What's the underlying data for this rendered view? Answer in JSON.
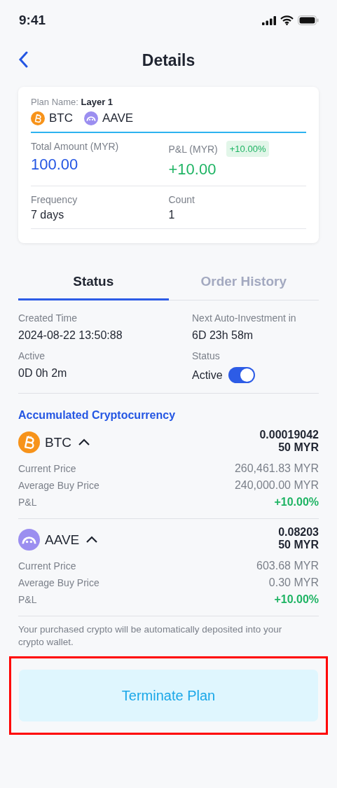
{
  "status_bar": {
    "time": "9:41"
  },
  "header": {
    "title": "Details"
  },
  "plan_card": {
    "plan_name_label": "Plan Name:",
    "plan_name": "Layer 1",
    "coins": [
      {
        "kind": "btc",
        "symbol": "BTC"
      },
      {
        "kind": "aave",
        "symbol": "AAVE"
      }
    ],
    "total_amount": {
      "label": "Total Amount (MYR)",
      "value": "100.00"
    },
    "pnl": {
      "label": "P&L (MYR)",
      "badge": "+10.00%",
      "value": "+10.00"
    },
    "frequency": {
      "label": "Frequency",
      "value": "7 days"
    },
    "count": {
      "label": "Count",
      "value": "1"
    }
  },
  "tabs": [
    {
      "label": "Status",
      "selected": true
    },
    {
      "label": "Order History",
      "selected": false
    }
  ],
  "status_info": {
    "created_label": "Created Time",
    "created_value": "2024-08-22 13:50:88",
    "next_label": "Next Auto-Investment in",
    "next_value": "6D 23h 58m",
    "active_label": "Active",
    "active_value": "0D 0h 2m",
    "status_label": "Status",
    "status_value": "Active",
    "toggle_on": true
  },
  "accumulated": {
    "title": "Accumulated Cryptocurrency",
    "assets": [
      {
        "kind": "btc",
        "symbol": "BTC",
        "expanded": true,
        "amount": "0.00019042",
        "value": "50 MYR",
        "rows": [
          {
            "kind": "plain",
            "label": "Current Price",
            "value": "260,461.83 MYR"
          },
          {
            "kind": "plain",
            "label": "Average Buy Price",
            "value": "240,000.00 MYR"
          },
          {
            "kind": "gain",
            "label": "P&L",
            "value": "+10.00%"
          }
        ]
      },
      {
        "kind": "aave",
        "symbol": "AAVE",
        "expanded": true,
        "amount": "0.08203",
        "value": "50 MYR",
        "rows": [
          {
            "kind": "plain",
            "label": "Current Price",
            "value": "603.68 MYR"
          },
          {
            "kind": "plain",
            "label": "Average Buy Price",
            "value": "0.30 MYR"
          },
          {
            "kind": "gain",
            "label": "P&L",
            "value": "+10.00%"
          }
        ]
      }
    ]
  },
  "note": "Your purchased crypto will be automatically deposited into your crypto wallet.",
  "terminate_button": {
    "label": "Terminate Plan",
    "highlighted": true
  }
}
